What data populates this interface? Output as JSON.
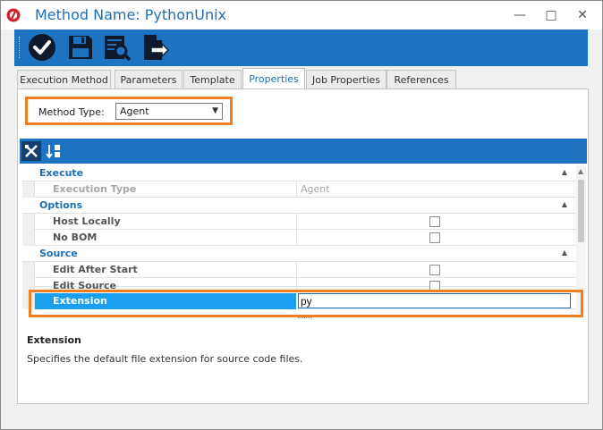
{
  "window": {
    "title": "Method Name: PythonUnix",
    "minimize_glyph": "—",
    "restore_glyph": "□",
    "close_glyph": "✕"
  },
  "toolbar": {
    "buttons": [
      {
        "name": "checkmark-icon"
      },
      {
        "name": "save-icon"
      },
      {
        "name": "preview-icon"
      },
      {
        "name": "export-icon"
      }
    ]
  },
  "tabs": [
    {
      "label": "Execution Method",
      "active": false
    },
    {
      "label": "Parameters",
      "active": false
    },
    {
      "label": "Template",
      "active": false
    },
    {
      "label": "Properties",
      "active": true
    },
    {
      "label": "Job Properties",
      "active": false
    },
    {
      "label": "References",
      "active": false
    }
  ],
  "method_type": {
    "label": "Method Type:",
    "value": "Agent"
  },
  "property_grid": {
    "toolbar": [
      {
        "name": "categorized-icon",
        "selected": true
      },
      {
        "name": "sort-alphabetical-icon",
        "selected": false
      }
    ],
    "rows": [
      {
        "type": "category",
        "label": "Execute"
      },
      {
        "type": "property",
        "label": "Execution Type",
        "value": "Agent",
        "disabled": true
      },
      {
        "type": "category",
        "label": "Options"
      },
      {
        "type": "property",
        "label": "Host Locally",
        "checkbox": true
      },
      {
        "type": "property",
        "label": "No BOM",
        "checkbox": true
      },
      {
        "type": "category",
        "label": "Source"
      },
      {
        "type": "property",
        "label": "Edit After Start",
        "checkbox": true
      },
      {
        "type": "property",
        "label": "Edit Source",
        "checkbox": true
      },
      {
        "type": "property",
        "label": "Extension",
        "value": "py",
        "selected": true
      }
    ]
  },
  "description": {
    "title": "Extension",
    "text": "Specifies the default file extension for source code files."
  },
  "colors": {
    "accent": "#1e73c0",
    "highlight": "#f07d22",
    "selection": "#1aa0ee"
  }
}
